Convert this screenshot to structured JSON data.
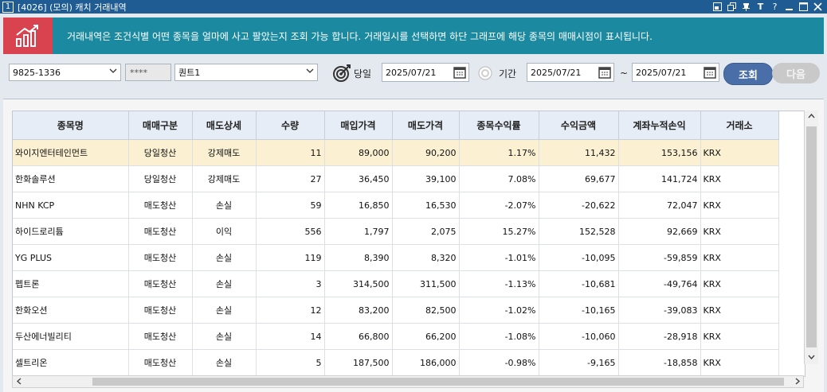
{
  "window": {
    "number": "1",
    "title": "[4026] (모의) 캐치 거래내역"
  },
  "banner": {
    "text": "거래내역은 조건식별 어떤 종목을 얼마에 사고 팔았는지 조회 가능 합니다. 거래일시를 선택하면 하단 그래프에 해당 종목의 매매시점이 표시됩니다."
  },
  "toolbar": {
    "account": "9825-1336",
    "password": "****",
    "strategy": "퀀트1",
    "trade_date_label": "당일",
    "trade_date": "2025/07/21",
    "period_label": "기간",
    "period_start": "2025/07/21",
    "period_sep": "~",
    "period_end": "2025/07/21",
    "search_button": "조회",
    "next_button": "다음"
  },
  "table": {
    "headers": [
      "종목명",
      "매매구분",
      "매도상세",
      "수량",
      "매입가격",
      "매도가격",
      "종목수익률",
      "수익금액",
      "계좌누적손익",
      "거래소"
    ],
    "rows": [
      [
        "와이지엔터테인먼트",
        "당일청산",
        "강제매도",
        "11",
        "89,000",
        "90,200",
        "1.17%",
        "11,432",
        "153,156",
        "KRX"
      ],
      [
        "한화솔루션",
        "당일청산",
        "강제매도",
        "27",
        "36,450",
        "39,100",
        "7.08%",
        "69,677",
        "141,724",
        "KRX"
      ],
      [
        "NHN KCP",
        "매도청산",
        "손실",
        "59",
        "16,850",
        "16,530",
        "-2.07%",
        "-20,622",
        "72,047",
        "KRX"
      ],
      [
        "하이드로리튬",
        "매도청산",
        "이익",
        "556",
        "1,797",
        "2,075",
        "15.27%",
        "152,528",
        "92,669",
        "KRX"
      ],
      [
        "YG PLUS",
        "매도청산",
        "손실",
        "119",
        "8,390",
        "8,320",
        "-1.01%",
        "-10,095",
        "-59,859",
        "KRX"
      ],
      [
        "펩트론",
        "매도청산",
        "손실",
        "3",
        "314,500",
        "311,500",
        "-1.13%",
        "-10,681",
        "-49,764",
        "KRX"
      ],
      [
        "한화오션",
        "매도청산",
        "손실",
        "12",
        "83,200",
        "82,500",
        "-1.02%",
        "-10,165",
        "-39,083",
        "KRX"
      ],
      [
        "두산에너빌리티",
        "매도청산",
        "손실",
        "14",
        "66,800",
        "66,200",
        "-1.08%",
        "-10,060",
        "-28,918",
        "KRX"
      ],
      [
        "셀트리온",
        "매도청산",
        "손실",
        "5",
        "187,500",
        "186,000",
        "-0.98%",
        "-9,165",
        "-18,858",
        "KRX"
      ]
    ]
  },
  "colors": {
    "titlebar": "#1f5c93",
    "banner": "#1b8aa0",
    "banner_icon_bg": "#d8434f",
    "search_button": "#4a6fa8",
    "selected_row": "#fbf1d2"
  },
  "icons": [
    "chart-growth-icon",
    "target-icon",
    "radio-icon",
    "calendar-icon"
  ]
}
